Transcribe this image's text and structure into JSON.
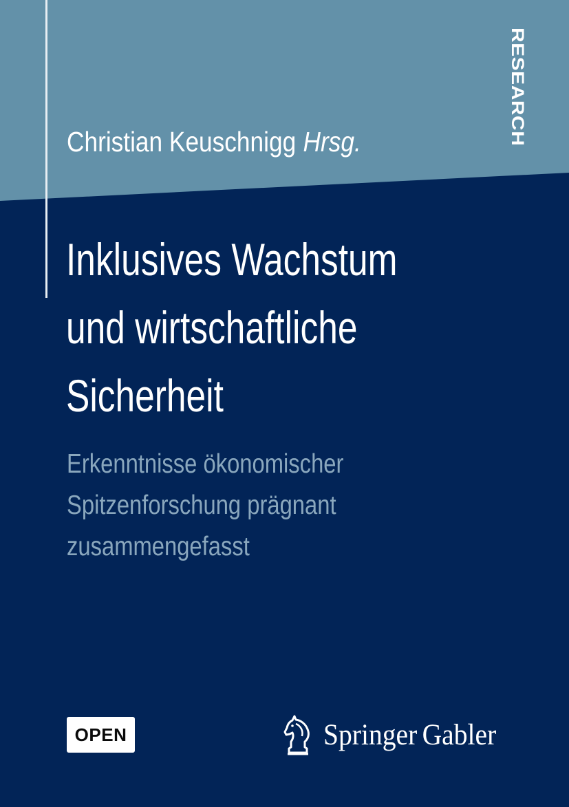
{
  "series": "RESEARCH",
  "author": {
    "name": "Christian Keuschnigg",
    "role": "Hrsg."
  },
  "title_lines": [
    "Inklusives Wachstum",
    "und wirtschaftliche",
    "Sicherheit"
  ],
  "subtitle_lines": [
    "Erkenntnisse ökonomischer",
    "Spitzenforschung prägnant",
    "zusammengefasst"
  ],
  "badge": "OPEN",
  "publisher": {
    "name": "Springer",
    "imprint": "Gabler",
    "logo_icon": "knight-horse-icon"
  },
  "colors": {
    "background": "#022457",
    "top_band": "#6391a9",
    "subtitle": "#8aa7bd",
    "text": "#ffffff"
  }
}
